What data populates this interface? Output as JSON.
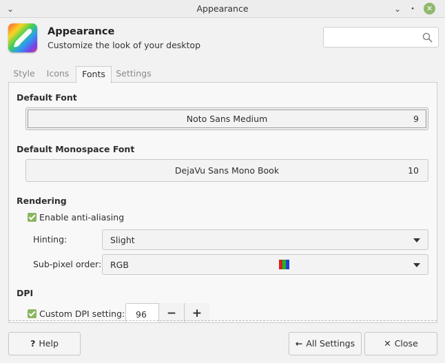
{
  "window": {
    "title": "Appearance"
  },
  "header": {
    "title": "Appearance",
    "subtitle": "Customize the look of your desktop",
    "search_placeholder": ""
  },
  "tabs": [
    {
      "label": "Style",
      "active": false
    },
    {
      "label": "Icons",
      "active": false
    },
    {
      "label": "Fonts",
      "active": true
    },
    {
      "label": "Settings",
      "active": false
    }
  ],
  "fonts": {
    "default_font_heading": "Default Font",
    "default_font_name": "Noto Sans Medium",
    "default_font_size": "9",
    "mono_font_heading": "Default Monospace Font",
    "mono_font_name": "DejaVu Sans Mono Book",
    "mono_font_size": "10"
  },
  "rendering": {
    "heading": "Rendering",
    "antialias_label": "Enable anti-aliasing",
    "antialias_checked": true,
    "hinting_label": "Hinting:",
    "hinting_value": "Slight",
    "subpixel_label": "Sub-pixel order:",
    "subpixel_value": "RGB"
  },
  "dpi": {
    "heading": "DPI",
    "custom_label": "Custom DPI setting:",
    "custom_checked": true,
    "value": "96",
    "minus": "−",
    "plus": "+"
  },
  "footer": {
    "help_label": "Help",
    "help_icon": "?",
    "all_settings_label": "All Settings",
    "all_settings_icon": "🡐",
    "close_label": "Close",
    "close_icon": "✕"
  },
  "colors": {
    "accent": "#8ab661",
    "swatch": [
      "#d62020",
      "#22b322",
      "#2240d6"
    ]
  }
}
